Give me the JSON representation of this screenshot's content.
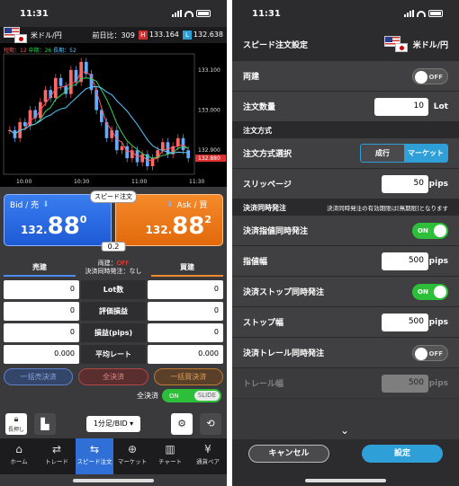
{
  "left": {
    "status_time": "11:31",
    "header": {
      "pair": "米ドル/円",
      "prev_label": "前日比：309",
      "high_badge": "H",
      "high": "133.164",
      "low_badge": "L",
      "low": "132.638"
    },
    "chart": {
      "ma_labels": [
        "短期：12",
        "中期：26",
        "長期：52"
      ],
      "y_ticks": [
        "133.100",
        "133.000",
        "132.900",
        "132.880"
      ],
      "x_ticks": [
        "10:00",
        "10:30",
        "11:00",
        "11:30"
      ]
    },
    "chart_data": {
      "type": "candlestick",
      "title": "",
      "x_ticks": [
        "10:00",
        "10:30",
        "11:00",
        "11:30"
      ],
      "y_ticks": [
        133.1,
        133.0,
        132.9
      ],
      "current_price": 132.88,
      "ylim": [
        132.84,
        133.14
      ],
      "series": [
        {
          "name": "短期：12",
          "color": "#ff5a5a"
        },
        {
          "name": "中期：26",
          "color": "#3ad25a"
        },
        {
          "name": "長期：52",
          "color": "#5ac8ff"
        }
      ]
    },
    "bid": {
      "label": "Bid / 売",
      "prefix": "132.",
      "big": "88",
      "sup": "0"
    },
    "ask": {
      "label": "Ask / 買",
      "prefix": "132.",
      "big": "88",
      "sup": "2"
    },
    "speed_chip": "スピード注文",
    "spread": "0.2",
    "position": {
      "sell": "売建",
      "buy": "買建",
      "both_label": "両建：",
      "both_value": "OFF",
      "settle_label": "決済同時発注：なし"
    },
    "rows": [
      {
        "left": "0",
        "label": "Lot数",
        "right": "0"
      },
      {
        "left": "0",
        "label": "評価損益",
        "right": "0"
      },
      {
        "left": "0",
        "label": "損益(pips)",
        "right": "0"
      },
      {
        "left": "0.000",
        "label": "平均レート",
        "right": "0.000"
      }
    ],
    "settle_buttons": [
      "一括売決済",
      "全決済",
      "一括買決済"
    ],
    "all_settle": {
      "label": "全決済",
      "on": "ON",
      "slide": "SLIDE"
    },
    "toolbar": {
      "lock": "長押し",
      "timeframe": "1分足/BID ▾"
    },
    "tabs": [
      {
        "icon": "⌂",
        "label": "ホーム"
      },
      {
        "icon": "⇄",
        "label": "トレード"
      },
      {
        "icon": "⇆",
        "label": "スピード注文"
      },
      {
        "icon": "⊕",
        "label": "マーケット"
      },
      {
        "icon": "▥",
        "label": "チャート"
      },
      {
        "icon": "¥",
        "label": "通貨ペア"
      }
    ]
  },
  "right": {
    "status_time": "11:31",
    "title": "スピード注文設定",
    "pair": "米ドル/円",
    "both": {
      "label": "両建",
      "toggle": "OFF"
    },
    "qty": {
      "label": "注文数量",
      "value": "10",
      "unit": "Lot"
    },
    "sec_method": "注文方式",
    "method": {
      "label": "注文方式選択",
      "opt1": "成行",
      "opt2": "マーケット"
    },
    "slippage": {
      "label": "スリッページ",
      "value": "50",
      "unit": "pips"
    },
    "sec_settle": "決済同時発注",
    "sec_settle_note": "決済同時発注の有効期限は[無期限]となります",
    "limit_simul": {
      "label": "決済指値同時発注",
      "toggle": "ON"
    },
    "limit_width": {
      "label": "指値幅",
      "value": "500",
      "unit": "pips"
    },
    "stop_simul": {
      "label": "決済ストップ同時発注",
      "toggle": "ON"
    },
    "stop_width": {
      "label": "ストップ幅",
      "value": "500",
      "unit": "pips"
    },
    "trail_simul": {
      "label": "決済トレール同時発注",
      "toggle": "OFF"
    },
    "trail_width": {
      "label": "トレール幅",
      "value": "500",
      "unit": "pips"
    },
    "cancel": "キャンセル",
    "ok": "設定"
  }
}
